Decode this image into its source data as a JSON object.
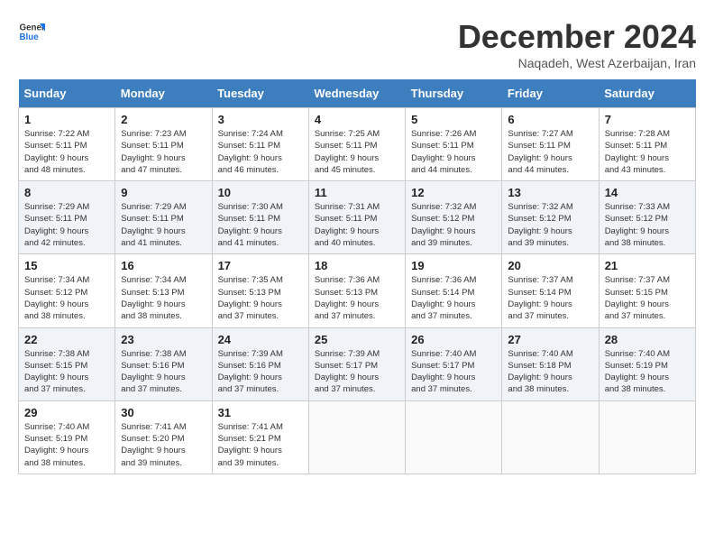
{
  "logo": {
    "line1": "General",
    "line2": "Blue"
  },
  "title": "December 2024",
  "subtitle": "Naqadeh, West Azerbaijan, Iran",
  "weekdays": [
    "Sunday",
    "Monday",
    "Tuesday",
    "Wednesday",
    "Thursday",
    "Friday",
    "Saturday"
  ],
  "weeks": [
    [
      {
        "day": "1",
        "info": "Sunrise: 7:22 AM\nSunset: 5:11 PM\nDaylight: 9 hours\nand 48 minutes."
      },
      {
        "day": "2",
        "info": "Sunrise: 7:23 AM\nSunset: 5:11 PM\nDaylight: 9 hours\nand 47 minutes."
      },
      {
        "day": "3",
        "info": "Sunrise: 7:24 AM\nSunset: 5:11 PM\nDaylight: 9 hours\nand 46 minutes."
      },
      {
        "day": "4",
        "info": "Sunrise: 7:25 AM\nSunset: 5:11 PM\nDaylight: 9 hours\nand 45 minutes."
      },
      {
        "day": "5",
        "info": "Sunrise: 7:26 AM\nSunset: 5:11 PM\nDaylight: 9 hours\nand 44 minutes."
      },
      {
        "day": "6",
        "info": "Sunrise: 7:27 AM\nSunset: 5:11 PM\nDaylight: 9 hours\nand 44 minutes."
      },
      {
        "day": "7",
        "info": "Sunrise: 7:28 AM\nSunset: 5:11 PM\nDaylight: 9 hours\nand 43 minutes."
      }
    ],
    [
      {
        "day": "8",
        "info": "Sunrise: 7:29 AM\nSunset: 5:11 PM\nDaylight: 9 hours\nand 42 minutes."
      },
      {
        "day": "9",
        "info": "Sunrise: 7:29 AM\nSunset: 5:11 PM\nDaylight: 9 hours\nand 41 minutes."
      },
      {
        "day": "10",
        "info": "Sunrise: 7:30 AM\nSunset: 5:11 PM\nDaylight: 9 hours\nand 41 minutes."
      },
      {
        "day": "11",
        "info": "Sunrise: 7:31 AM\nSunset: 5:11 PM\nDaylight: 9 hours\nand 40 minutes."
      },
      {
        "day": "12",
        "info": "Sunrise: 7:32 AM\nSunset: 5:12 PM\nDaylight: 9 hours\nand 39 minutes."
      },
      {
        "day": "13",
        "info": "Sunrise: 7:32 AM\nSunset: 5:12 PM\nDaylight: 9 hours\nand 39 minutes."
      },
      {
        "day": "14",
        "info": "Sunrise: 7:33 AM\nSunset: 5:12 PM\nDaylight: 9 hours\nand 38 minutes."
      }
    ],
    [
      {
        "day": "15",
        "info": "Sunrise: 7:34 AM\nSunset: 5:12 PM\nDaylight: 9 hours\nand 38 minutes."
      },
      {
        "day": "16",
        "info": "Sunrise: 7:34 AM\nSunset: 5:13 PM\nDaylight: 9 hours\nand 38 minutes."
      },
      {
        "day": "17",
        "info": "Sunrise: 7:35 AM\nSunset: 5:13 PM\nDaylight: 9 hours\nand 37 minutes."
      },
      {
        "day": "18",
        "info": "Sunrise: 7:36 AM\nSunset: 5:13 PM\nDaylight: 9 hours\nand 37 minutes."
      },
      {
        "day": "19",
        "info": "Sunrise: 7:36 AM\nSunset: 5:14 PM\nDaylight: 9 hours\nand 37 minutes."
      },
      {
        "day": "20",
        "info": "Sunrise: 7:37 AM\nSunset: 5:14 PM\nDaylight: 9 hours\nand 37 minutes."
      },
      {
        "day": "21",
        "info": "Sunrise: 7:37 AM\nSunset: 5:15 PM\nDaylight: 9 hours\nand 37 minutes."
      }
    ],
    [
      {
        "day": "22",
        "info": "Sunrise: 7:38 AM\nSunset: 5:15 PM\nDaylight: 9 hours\nand 37 minutes."
      },
      {
        "day": "23",
        "info": "Sunrise: 7:38 AM\nSunset: 5:16 PM\nDaylight: 9 hours\nand 37 minutes."
      },
      {
        "day": "24",
        "info": "Sunrise: 7:39 AM\nSunset: 5:16 PM\nDaylight: 9 hours\nand 37 minutes."
      },
      {
        "day": "25",
        "info": "Sunrise: 7:39 AM\nSunset: 5:17 PM\nDaylight: 9 hours\nand 37 minutes."
      },
      {
        "day": "26",
        "info": "Sunrise: 7:40 AM\nSunset: 5:17 PM\nDaylight: 9 hours\nand 37 minutes."
      },
      {
        "day": "27",
        "info": "Sunrise: 7:40 AM\nSunset: 5:18 PM\nDaylight: 9 hours\nand 38 minutes."
      },
      {
        "day": "28",
        "info": "Sunrise: 7:40 AM\nSunset: 5:19 PM\nDaylight: 9 hours\nand 38 minutes."
      }
    ],
    [
      {
        "day": "29",
        "info": "Sunrise: 7:40 AM\nSunset: 5:19 PM\nDaylight: 9 hours\nand 38 minutes."
      },
      {
        "day": "30",
        "info": "Sunrise: 7:41 AM\nSunset: 5:20 PM\nDaylight: 9 hours\nand 39 minutes."
      },
      {
        "day": "31",
        "info": "Sunrise: 7:41 AM\nSunset: 5:21 PM\nDaylight: 9 hours\nand 39 minutes."
      },
      {
        "day": "",
        "info": ""
      },
      {
        "day": "",
        "info": ""
      },
      {
        "day": "",
        "info": ""
      },
      {
        "day": "",
        "info": ""
      }
    ]
  ]
}
